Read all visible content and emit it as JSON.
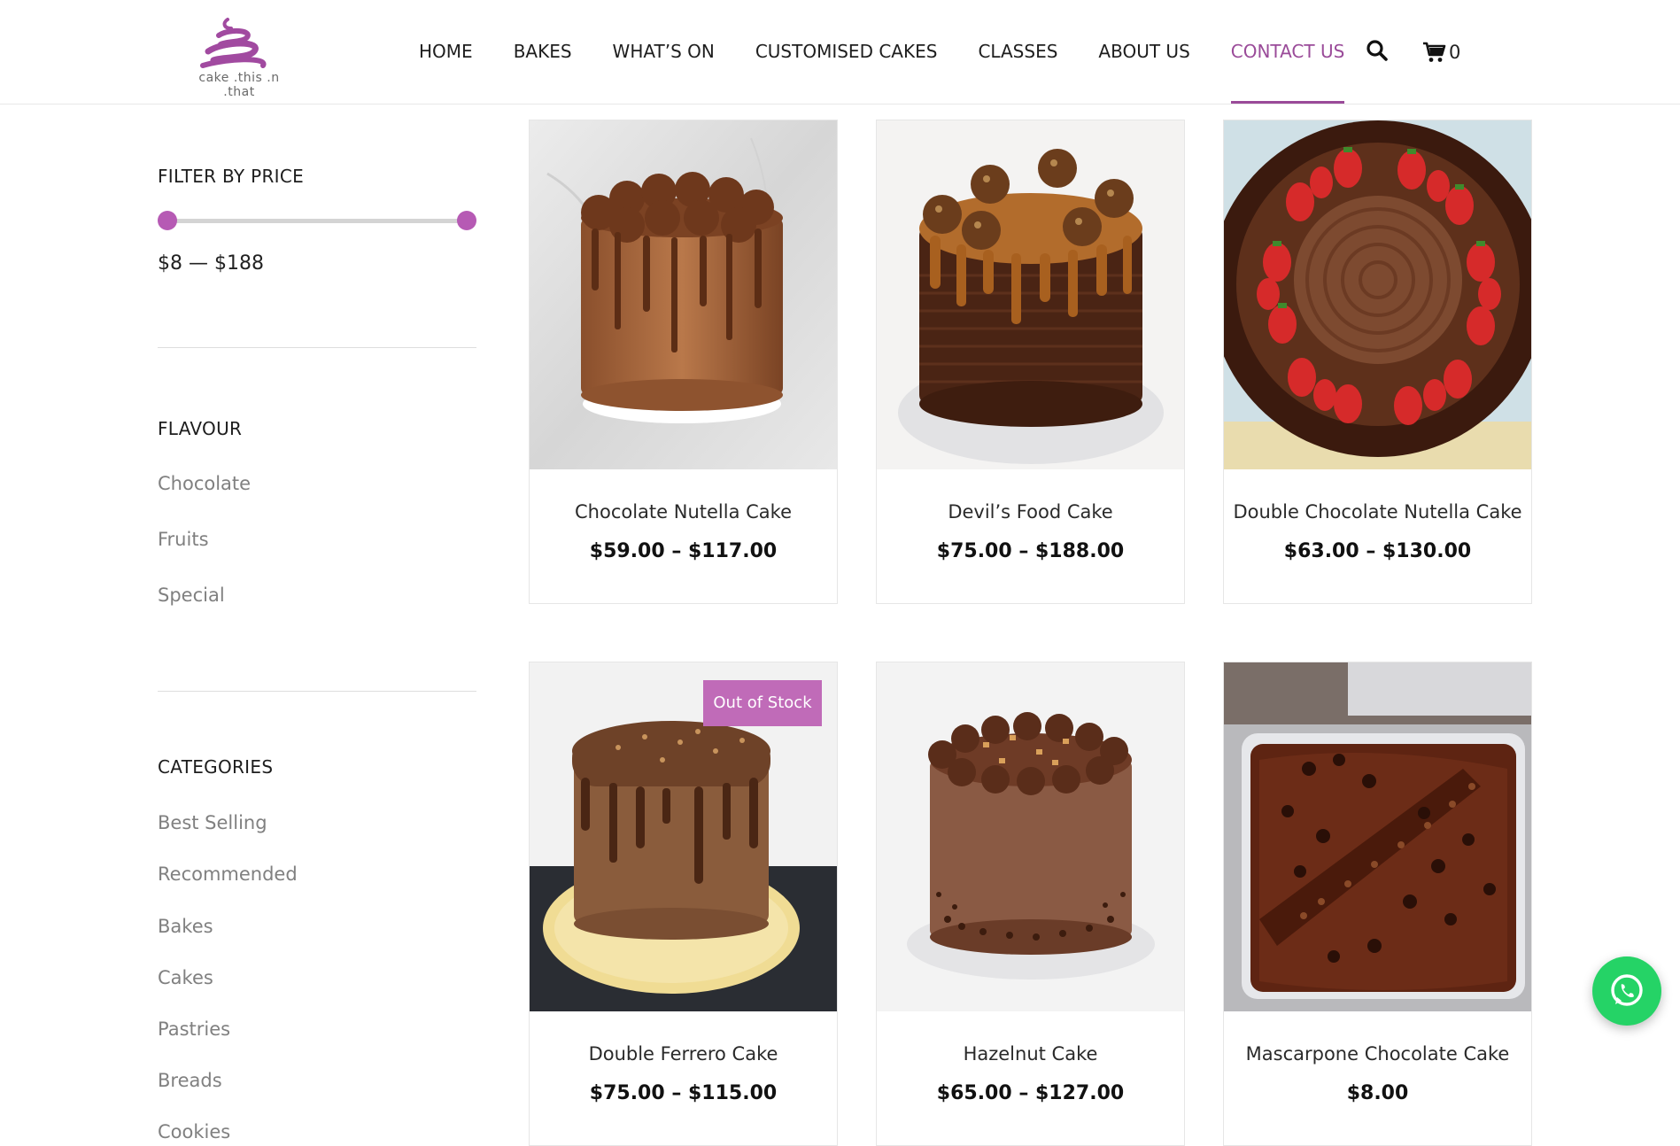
{
  "brand": {
    "logo_text": "cake .this .n .that"
  },
  "nav": {
    "items": [
      {
        "label": "HOME"
      },
      {
        "label": "BAKES"
      },
      {
        "label": "WHAT’S ON"
      },
      {
        "label": "CUSTOMISED CAKES"
      },
      {
        "label": "CLASSES"
      },
      {
        "label": "ABOUT US"
      },
      {
        "label": "CONTACT US",
        "active": true
      }
    ],
    "cart_count": "0",
    "search_icon": "search-icon",
    "cart_icon": "cart-icon"
  },
  "sidebar": {
    "price_filter": {
      "title": "FILTER BY PRICE",
      "range_text": "$8 — $188",
      "min": 8,
      "max": 188
    },
    "flavour": {
      "title": "FLAVOUR",
      "items": [
        "Chocolate",
        "Fruits",
        "Special"
      ]
    },
    "categories": {
      "title": "CATEGORIES",
      "items": [
        "Best Selling",
        "Recommended",
        "Bakes",
        "Cakes",
        "Pastries",
        "Breads",
        "Cookies"
      ]
    }
  },
  "products": [
    {
      "name": "Chocolate Nutella Cake",
      "price": "$59.00 – $117.00"
    },
    {
      "name": "Devil’s Food Cake",
      "price": "$75.00 – $188.00"
    },
    {
      "name": "Double Chocolate Nutella Cake",
      "price": "$63.00 – $130.00"
    },
    {
      "name": "Double Ferrero Cake",
      "price": "$75.00 – $115.00",
      "badge": "Out of Stock"
    },
    {
      "name": "Hazelnut Cake",
      "price": "$65.00 – $127.00"
    },
    {
      "name": "Mascarpone Chocolate Cake",
      "price": "$8.00"
    }
  ],
  "colors": {
    "accent": "#9a4b99",
    "badge": "#c06bb8",
    "slider": "#b65ab4",
    "whatsapp": "#25d366"
  },
  "floating": {
    "whatsapp_icon": "whatsapp-icon"
  }
}
